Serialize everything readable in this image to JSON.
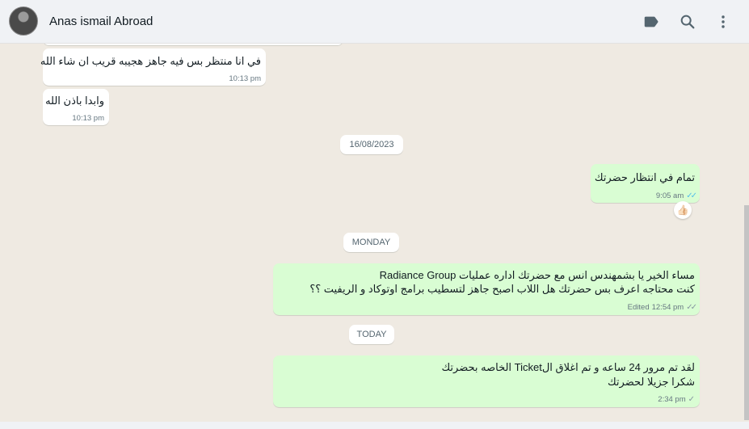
{
  "header": {
    "contact_name": "Anas ismail Abroad",
    "icons": [
      "label-icon",
      "search-icon",
      "menu-icon"
    ]
  },
  "messages": [
    {
      "direction": "incoming",
      "text": "في انا منتظر بس فيه جاهز هجيبه قريب ان شاء الله",
      "time": "10:13 pm"
    },
    {
      "direction": "incoming",
      "text": "وابدا باذن الله",
      "time": "10:13 pm"
    },
    {
      "date_chip": "16/08/2023"
    },
    {
      "direction": "outgoing",
      "text": "تمام في انتظار حضرتك",
      "time": "9:05 am",
      "status": "read",
      "reaction": "👍🏻"
    },
    {
      "date_chip": "MONDAY"
    },
    {
      "direction": "outgoing",
      "lines": [
        "مساء الخير يا بشمهندس انس مع حضرتك اداره عمليات Radiance Group",
        "كنت محتاجه اعرف بس حضرتك هل اللاب  اصبح جاهز  لتسطيب برامج اوتوكاد و الريفيت ؟؟"
      ],
      "edited_label": "Edited",
      "time": "12:54 pm",
      "status": "delivered"
    },
    {
      "date_chip": "TODAY"
    },
    {
      "direction": "outgoing",
      "lines": [
        "لقد تم مرور 24 ساعه و تم اغلاق الTicket الخاصه بحضرتك",
        "شكرا جزيلا لحضرتك"
      ],
      "time": "2:34 pm",
      "status": "sent"
    }
  ],
  "colors": {
    "outgoing_bubble": "#d9fdd3",
    "incoming_bubble": "#ffffff",
    "chat_background": "#efeae2",
    "read_tick": "#53bdeb"
  }
}
